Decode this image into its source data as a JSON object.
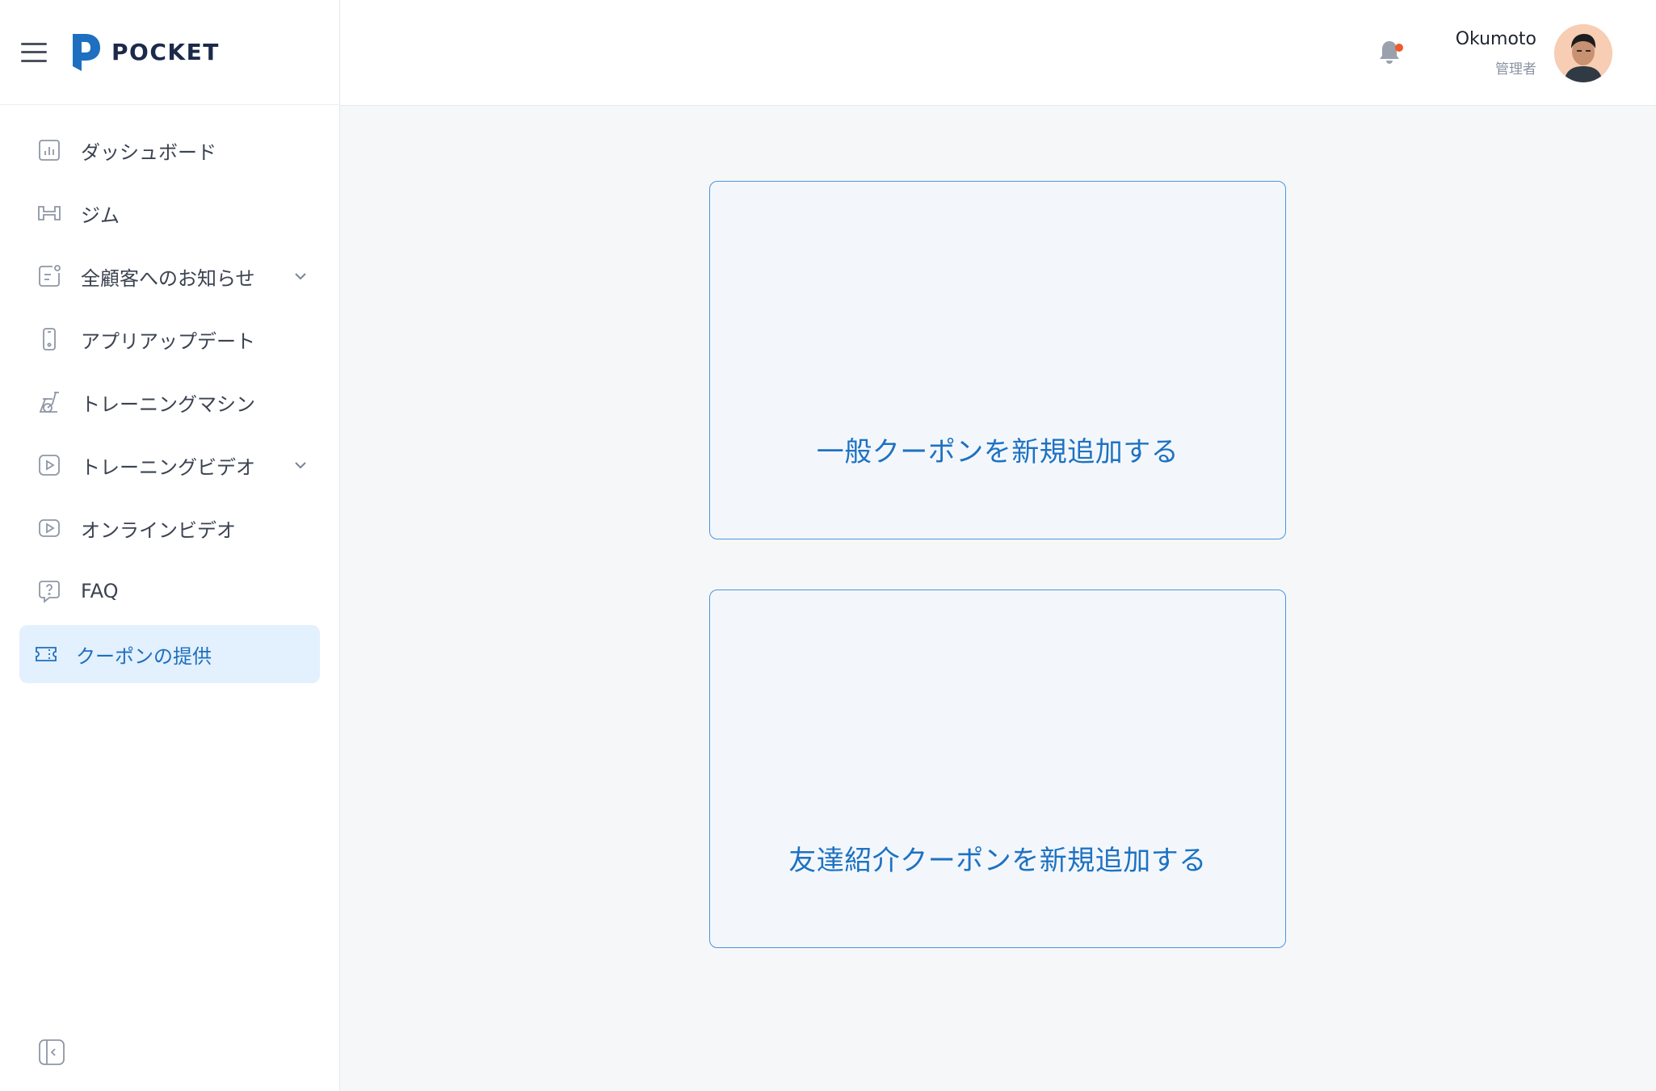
{
  "brand": {
    "name": "POCKET",
    "color": "#1e6fbf"
  },
  "sidebar": {
    "items": [
      {
        "label": "ダッシュボード",
        "icon": "chart-icon",
        "expandable": false,
        "active": false
      },
      {
        "label": "ジム",
        "icon": "gym-icon",
        "expandable": false,
        "active": false
      },
      {
        "label": "全顧客へのお知らせ",
        "icon": "announcement-icon",
        "expandable": true,
        "active": false
      },
      {
        "label": "アプリアップデート",
        "icon": "phone-icon",
        "expandable": false,
        "active": false
      },
      {
        "label": "トレーニングマシン",
        "icon": "bike-icon",
        "expandable": false,
        "active": false
      },
      {
        "label": "トレーニングビデオ",
        "icon": "video-icon",
        "expandable": true,
        "active": false
      },
      {
        "label": "オンラインビデオ",
        "icon": "video-icon",
        "expandable": false,
        "active": false
      },
      {
        "label": "FAQ",
        "icon": "help-bubble-icon",
        "expandable": false,
        "active": false
      },
      {
        "label": "クーポンの提供",
        "icon": "ticket-icon",
        "expandable": false,
        "active": true
      }
    ]
  },
  "header": {
    "user_name": "Okumoto",
    "user_role": "管理者",
    "notification_dot_color": "#f0592a"
  },
  "main": {
    "cards": [
      {
        "label": "一般クーポンを新規追加する"
      },
      {
        "label": "友達紹介クーポンを新規追加する"
      }
    ]
  }
}
